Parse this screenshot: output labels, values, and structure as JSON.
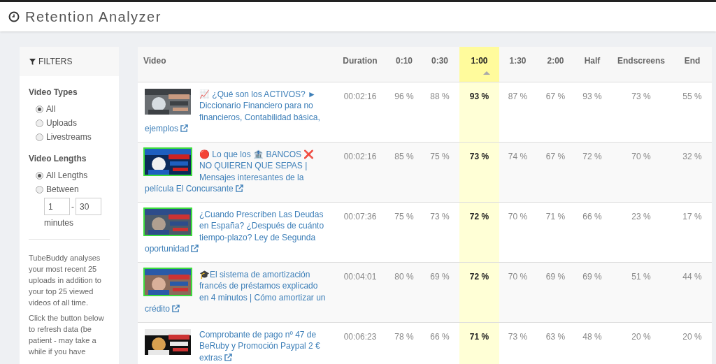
{
  "header": {
    "title": "Retention Analyzer"
  },
  "filters": {
    "title": "FILTERS",
    "groups": [
      {
        "heading": "Video Types",
        "options": [
          {
            "label": "All",
            "selected": true
          },
          {
            "label": "Uploads",
            "selected": false
          },
          {
            "label": "Livestreams",
            "selected": false
          }
        ]
      },
      {
        "heading": "Video Lengths",
        "options": [
          {
            "label": "All Lengths",
            "selected": true
          },
          {
            "label": "Between",
            "selected": false
          }
        ]
      }
    ],
    "range": {
      "min": "1",
      "separator": "-",
      "max": "30",
      "unit": "minutes"
    },
    "notes": [
      "TubeBuddy analyses your most recent 25 uploads in addition to your top 25 viewed videos of all time.",
      "Click the button below to refresh data (be patient - may take a while if you have"
    ]
  },
  "table": {
    "columns": [
      {
        "label": "Video",
        "sorted": false
      },
      {
        "label": "Duration",
        "sorted": false
      },
      {
        "label": "0:10",
        "sorted": false
      },
      {
        "label": "0:30",
        "sorted": false
      },
      {
        "label": "1:00",
        "sorted": true
      },
      {
        "label": "1:30",
        "sorted": false
      },
      {
        "label": "2:00",
        "sorted": false
      },
      {
        "label": "Half",
        "sorted": false
      },
      {
        "label": "Endscreens",
        "sorted": false
      },
      {
        "label": "End",
        "sorted": false
      }
    ],
    "rows": [
      {
        "outlined": false,
        "cells": [
          "📈 ¿Qué son los ACTIVOS? ► Diccionario Financiero para no financieros, Contabilidad básica, ejemplos",
          "00:02:16",
          "96 %",
          "88 %",
          "93 %",
          "87 %",
          "67 %",
          "93 %",
          "73 %",
          "55 %"
        ]
      },
      {
        "outlined": true,
        "cells": [
          "🔴 Lo que los 🏦 BANCOS ❌ NO QUIEREN QUE SEPAS | Mensajes interesantes de la película El Concursante",
          "00:02:16",
          "85 %",
          "75 %",
          "73 %",
          "74 %",
          "67 %",
          "72 %",
          "70 %",
          "32 %"
        ]
      },
      {
        "outlined": true,
        "cells": [
          "¿Cuando Prescriben Las Deudas en España? ¿Después de cuánto tiempo-plazo? Ley de Segunda oportunidad",
          "00:07:36",
          "75 %",
          "73 %",
          "72 %",
          "70 %",
          "71 %",
          "66 %",
          "23 %",
          "17 %"
        ]
      },
      {
        "outlined": true,
        "cells": [
          "🎓El sistema de amortización francés de préstamos explicado en 4 minutos | Cómo amortizar un crédito",
          "00:04:01",
          "80 %",
          "69 %",
          "72 %",
          "70 %",
          "69 %",
          "69 %",
          "51 %",
          "44 %"
        ]
      },
      {
        "outlined": false,
        "cells": [
          "Comprobante de pago nº 47 de BeRuby y Promoción Paypal 2 € extras",
          "00:06:23",
          "78 %",
          "66 %",
          "71 %",
          "73 %",
          "63 %",
          "48 %",
          "20 %",
          "20 %"
        ]
      }
    ]
  }
}
